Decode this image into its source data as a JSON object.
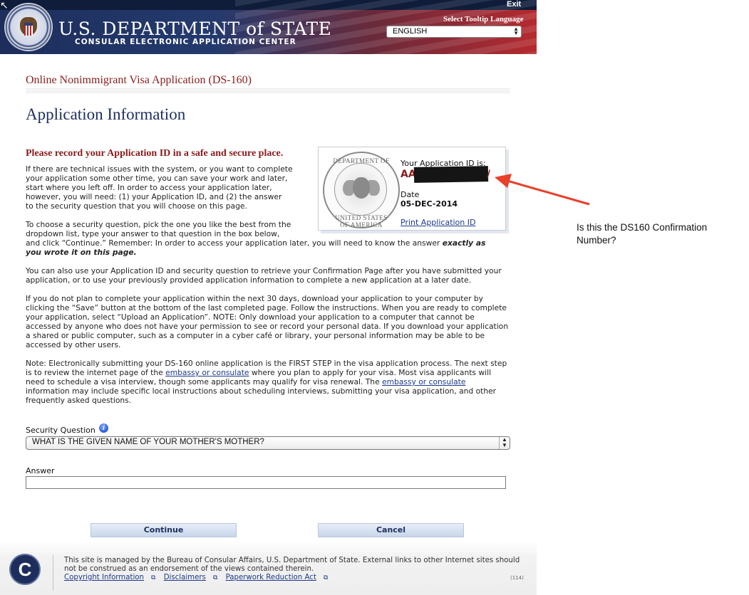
{
  "header": {
    "department_title": "U.S. DEPARTMENT of STATE",
    "subtitle": "CONSULAR ELECTRONIC APPLICATION CENTER",
    "exit_label": "Exit",
    "tooltip_language_label": "Select Tooltip Language",
    "language_selected": "ENGLISH"
  },
  "page": {
    "form_title": "Online Nonimmigrant Visa Application (DS-160)",
    "heading": "Application Information",
    "record_heading": "Please record your Application ID in a safe and secure place."
  },
  "paragraphs": {
    "p1_lines": [
      "If there are technical issues with the system, or you want to complete",
      "your application some other time, you can save your work and later,",
      "start where you left off. In order to access your application later,",
      "however, you will need: (1) your Application ID, and (2) the answer",
      "to the security question that you will choose on this page."
    ],
    "p2_lines": [
      "To choose a security question, pick the one you like the best from the",
      "dropdown list, type your answer to that question in the box below,"
    ],
    "p2_last_prefix": "and click “Continue.” Remember: In order to access your application later, you will need to know the answer",
    "p2_emph_1": "exactly as",
    "p2_emph_2": "you wrote it on this page.",
    "p3": "You can also use your Application ID and security question to retrieve your Confirmation Page after you have submitted your application, or to use your previously provided application information to complete a new application at a later date.",
    "p4": "If you do not plan to complete your application within the next 30 days, download your application to your computer by clicking the “Save” button at the bottom of the last completed page. Follow the instructions. When you are ready to complete your application, select “Upload an Application”. NOTE: Only download your application to a computer that cannot be accessed by anyone who does not have your permission to see or record your personal data. If you download your application a shared or public computer, such as a computer in a cyber café or library, your personal information may be able to be accessed by other users.",
    "p5_a": "Note: Electronically submitting your DS-160 online application is the FIRST STEP in the visa application process. The next step is to review the internet page of the",
    "p5_link1": "embassy or consulate",
    "p5_b": "where you plan to apply for your visa. Most visa applicants will need to schedule a visa interview, though some applicants may qualify for visa renewal. The",
    "p5_link2": "embassy or consulate",
    "p5_c": "information may include specific local instructions about scheduling interviews, submitting your visa application, and other frequently asked questions."
  },
  "appid_box": {
    "seal_text_top": "DEPARTMENT OF STATE",
    "seal_text_bottom": "UNITED STATES OF AMERICA",
    "label": "Your Application ID is:",
    "id_visible_prefix": "AA",
    "id_visible_suffix": "/",
    "date_label": "Date",
    "date_value": "05-DEC-2014",
    "print_link": "Print Application ID"
  },
  "annotation": {
    "text": "Is this the DS160 Confirmation Number?",
    "arrow_color": "#e8402a"
  },
  "security": {
    "question_label": "Security Question",
    "question_selected": "WHAT IS THE GIVEN NAME OF YOUR MOTHER'S MOTHER?",
    "answer_label": "Answer",
    "answer_value": ""
  },
  "buttons": {
    "continue_label": "Continue",
    "cancel_label": "Cancel"
  },
  "footer": {
    "logo_letter": "C",
    "text": "This site is managed by the Bureau of Consular Affairs, U.S. Department of State. External links to other Internet sites should not be construed as an endorsement of the views contained therein.",
    "links": [
      "Copyright Information",
      "Disclaimers",
      "Paperwork Reduction Act"
    ],
    "code": "(114)"
  },
  "colors": {
    "brand_navy": "#1d2e5c",
    "heading_red": "#8a1a1a",
    "link_blue": "#1d3a8a"
  }
}
